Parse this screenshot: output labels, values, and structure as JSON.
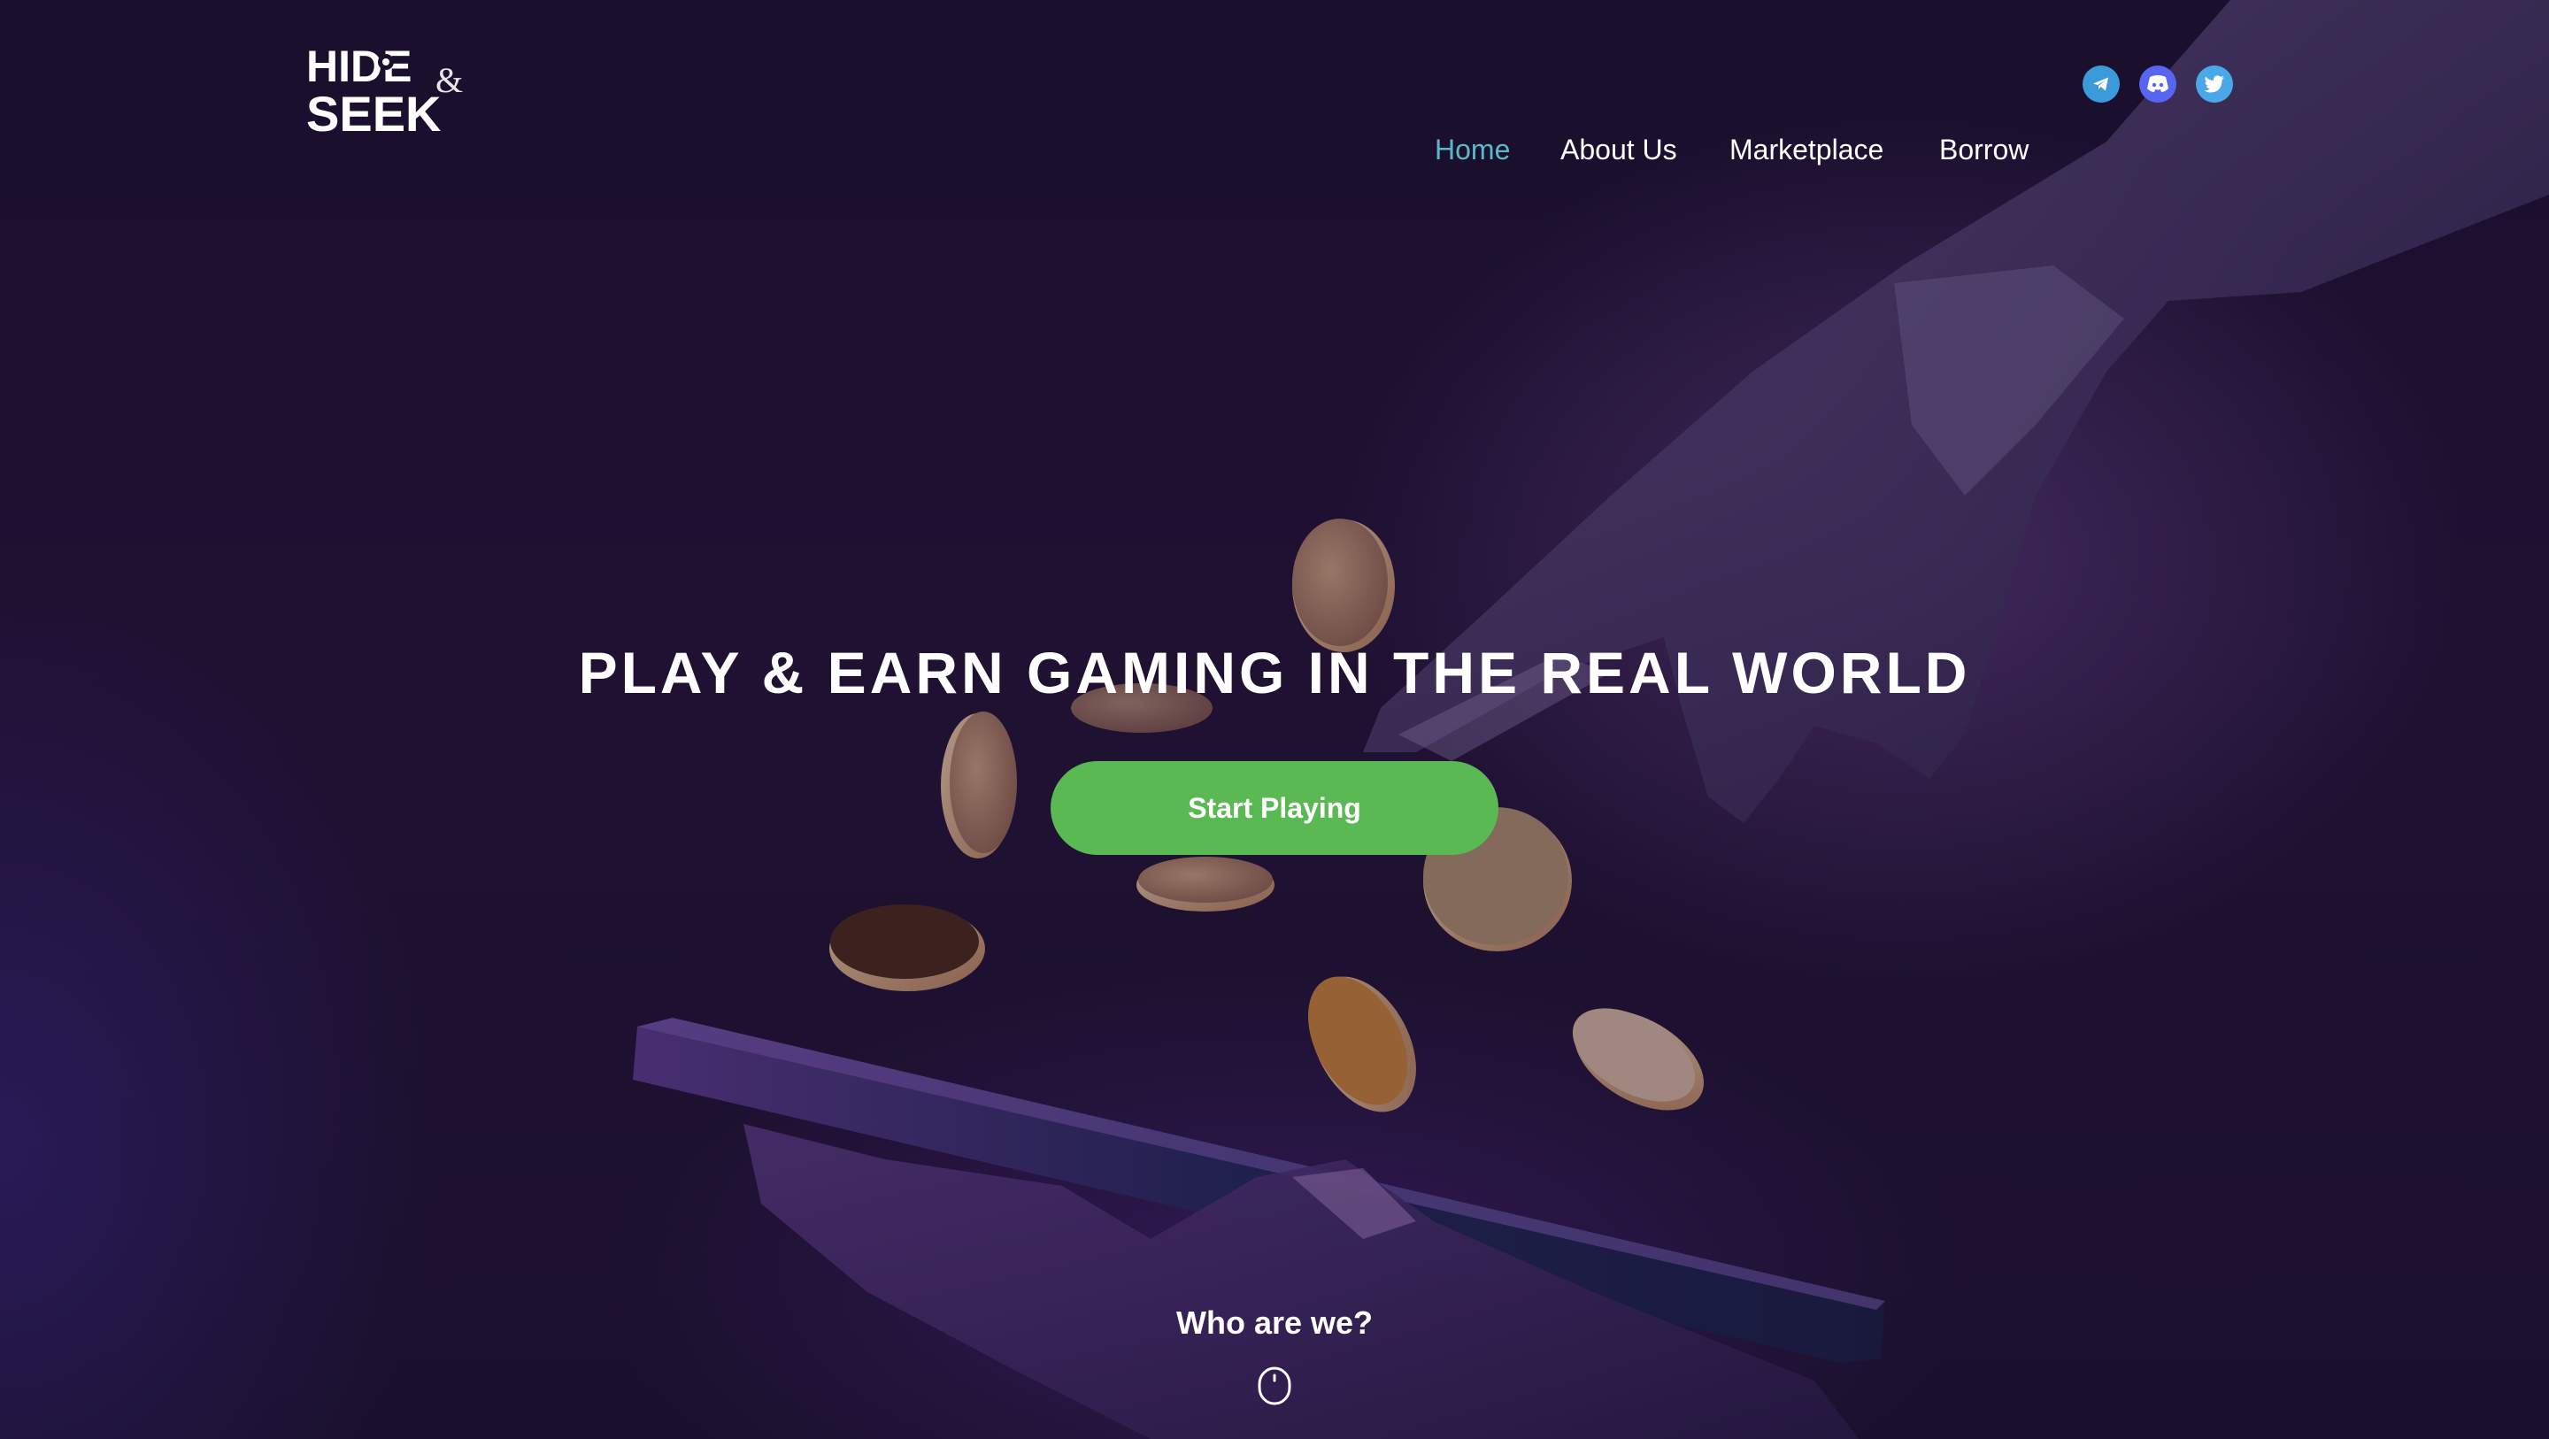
{
  "brand": {
    "logo_line1": "HIDE",
    "logo_line2": "SEEK",
    "logo_amp": "&"
  },
  "nav": {
    "items": [
      {
        "label": "Home",
        "active": true
      },
      {
        "label": "About Us",
        "active": false
      },
      {
        "label": "Marketplace",
        "active": false
      },
      {
        "label": "Borrow",
        "active": false
      }
    ],
    "active_color": "#5bb8c9"
  },
  "social": [
    {
      "icon": "telegram-icon",
      "color": "#3b9ad9"
    },
    {
      "icon": "discord-icon",
      "color": "#5865f2"
    },
    {
      "icon": "twitter-icon",
      "color": "#4aa8e8"
    }
  ],
  "hero": {
    "headline_bold": "PLAY & EARN",
    "headline_rest": "GAMING IN THE REAL WORLD",
    "cta_label": "Start Playing",
    "cta_color": "#5bb954",
    "scroll_label": "Who are we?",
    "scroll_icon": "mouse-scroll-icon"
  }
}
